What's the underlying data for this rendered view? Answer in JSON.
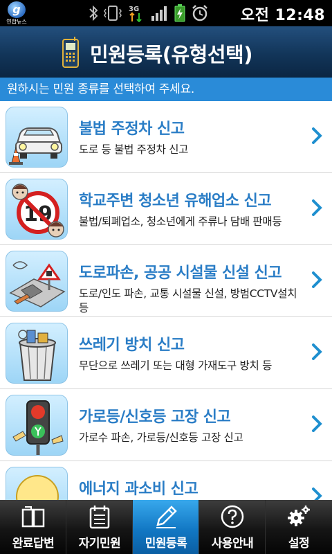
{
  "status_bar": {
    "app_label": "연합뉴스",
    "app_letter": "g",
    "network": "3G",
    "time": "오전 12:48",
    "icons": [
      "bluetooth-icon",
      "vibrate-icon",
      "network-3g-icon",
      "signal-icon",
      "battery-charging-icon",
      "alarm-icon"
    ]
  },
  "header": {
    "title": "민원등록(유형선택)",
    "icon": "phone-icon"
  },
  "instruction": "원하시는 민원 종류를 선택하여 주세요.",
  "items": [
    {
      "title": "불법 주정차 신고",
      "desc": "도로 등 불법 주정차 신고",
      "icon": "car-icon"
    },
    {
      "title": "학교주변 청소년 유해업소 신고",
      "desc": "불법/퇴폐업소, 청소년에게 주류나 담배 판매등",
      "icon": "no-under-19-icon"
    },
    {
      "title": "도로파손, 공공 시설물 신설 신고",
      "desc": "도로/인도 파손, 교통 시설물 신설, 방범CCTV설치 등",
      "icon": "road-damage-icon"
    },
    {
      "title": "쓰레기 방치 신고",
      "desc": "무단으로 쓰레기 또는 대형 가재도구 방치 등",
      "icon": "trash-can-icon"
    },
    {
      "title": "가로등/신호등 고장 신고",
      "desc": "가로수 파손, 가로등/신호등 고장 신고",
      "icon": "traffic-light-icon"
    },
    {
      "title": "에너지 과소비 신고",
      "desc": "",
      "icon": "light-bulb-icon"
    }
  ],
  "tabs": [
    {
      "label": "완료답변",
      "icon": "book-icon",
      "active": false
    },
    {
      "label": "자기민원",
      "icon": "calendar-icon",
      "active": false
    },
    {
      "label": "민원등록",
      "icon": "pencil-icon",
      "active": true
    },
    {
      "label": "사용안내",
      "icon": "question-icon",
      "active": false
    },
    {
      "label": "설정",
      "icon": "gear-icon",
      "active": false
    }
  ],
  "colors": {
    "title_bar": "#123559",
    "instruction_bar": "#2a8bd8",
    "item_title": "#2a7dc6",
    "chevron": "#1e8fcf",
    "active_tab": "#1278c4"
  }
}
